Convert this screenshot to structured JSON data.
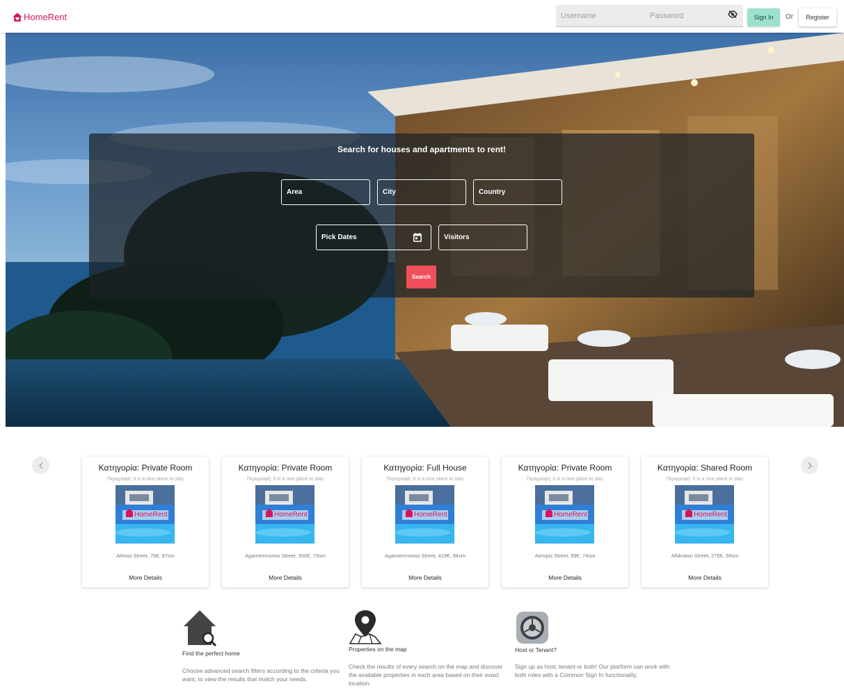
{
  "brand": {
    "name": "HomeRent",
    "color": "#d8135b"
  },
  "header": {
    "username_placeholder": "Username",
    "password_placeholder": "Password",
    "signin_label": "Sign In",
    "or_label": "Or",
    "register_label": "Register",
    "icons": {
      "password_toggle": "eye-off-icon",
      "logo": "house-icon"
    }
  },
  "search": {
    "title": "Search for houses and apartments to rent!",
    "area_placeholder": "Area",
    "city_placeholder": "City",
    "country_placeholder": "Country",
    "dates_placeholder": "Pick Dates",
    "visitors_placeholder": "Visitors",
    "button_label": "Search",
    "button_color": "#ef4f5b",
    "icons": {
      "dates": "calendar-icon"
    }
  },
  "carousel": {
    "icons": {
      "prev": "chevron-left-icon",
      "next": "chevron-right-icon"
    },
    "cards": [
      {
        "title": "Κατηγορία: Private Room",
        "description": "Περιγραφή: It is a nice place to stay",
        "address": "Alimos Street, 76€, 87sm",
        "link": "More Details",
        "image_label": "HomeRent"
      },
      {
        "title": "Κατηγορία: Private Room",
        "description": "Περιγραφή: It is a nice place to stay",
        "address": "Agamemnonos Street, 300€, 73sm",
        "link": "More Details",
        "image_label": "HomeRent"
      },
      {
        "title": "Κατηγορία: Full House",
        "description": "Περιγραφή: It is a nice place to stay",
        "address": "Agamemnonos Street, 419€, 94sm",
        "link": "More Details",
        "image_label": "HomeRent"
      },
      {
        "title": "Κατηγορία: Private Room",
        "description": "Περιγραφή: It is a nice place to stay",
        "address": "Aeropis Street, 69€, 74sm",
        "link": "More Details",
        "image_label": "HomeRent"
      },
      {
        "title": "Κατηγορία: Shared Room",
        "description": "Περιγραφή: It is a nice place to stay",
        "address": "Afidnaion Street, 275€, 59sm",
        "link": "More Details",
        "image_label": "HomeRent"
      }
    ]
  },
  "features": [
    {
      "title": "Find the perfect home",
      "text": "Choose advanced search filters according to the criteria you want, to view the results that match your needs.",
      "icon": "house-search-icon"
    },
    {
      "title": "Properties on the map",
      "text": "Check the results of every search on the map and discover the available properties in each area based on their exact location.",
      "icon": "map-pin-icon"
    },
    {
      "title": "Host or Tenant?",
      "text": "Sign up as host, tenant or both! Our plarform can work with both roles with a Common Sign In functionality.",
      "icon": "settings-gear-icon"
    }
  ]
}
